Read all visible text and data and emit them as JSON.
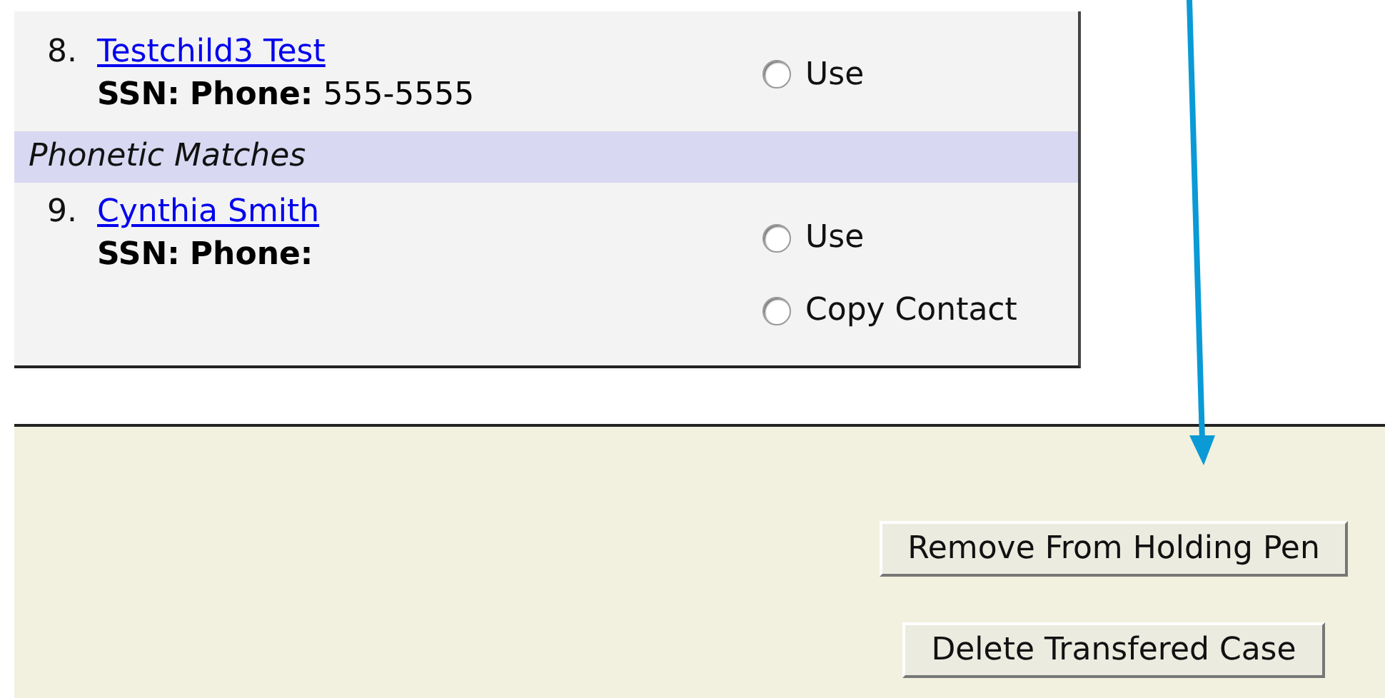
{
  "matches": [
    {
      "kind": "match",
      "number": "8.",
      "name": "Testchild3 Test",
      "ssn_label": "SSN:",
      "phone_label": "Phone:",
      "phone": "555-5555",
      "options": [
        {
          "label": "Use",
          "selected": false
        }
      ]
    },
    {
      "kind": "section",
      "title": "Phonetic Matches"
    },
    {
      "kind": "match",
      "number": "9.",
      "name": "Cynthia Smith",
      "ssn_label": "SSN:",
      "phone_label": "Phone:",
      "options": [
        {
          "label": "Use",
          "selected": false
        },
        {
          "label": "Copy Contact",
          "selected": false
        }
      ]
    }
  ],
  "buttons": [
    "Remove From Holding Pen",
    "Delete Transfered Case"
  ]
}
